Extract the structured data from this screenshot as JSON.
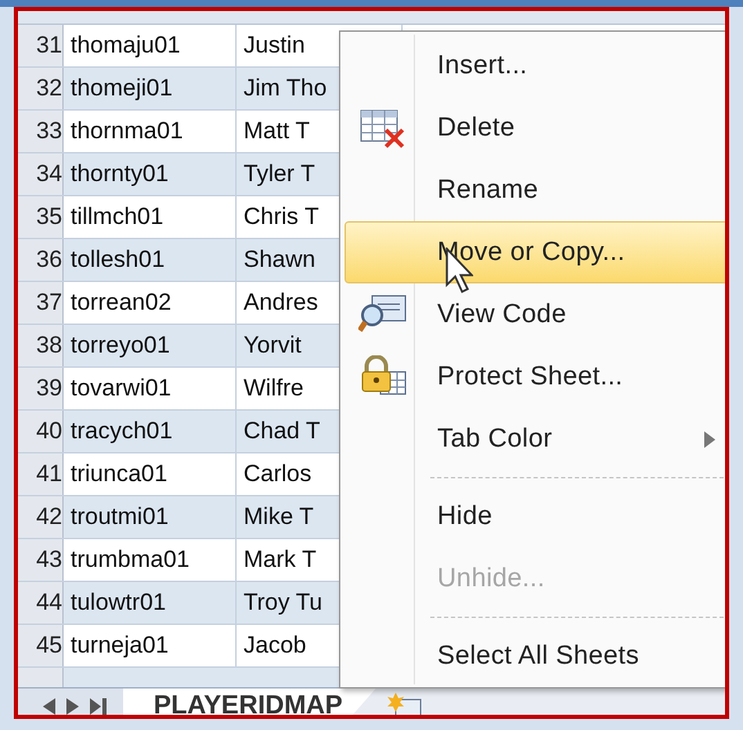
{
  "rows": [
    {
      "number": "31",
      "id": "thomaju01",
      "name": "Justin"
    },
    {
      "number": "32",
      "id": "thomeji01",
      "name": "Jim Tho"
    },
    {
      "number": "33",
      "id": "thornma01",
      "name": "Matt T"
    },
    {
      "number": "34",
      "id": "thornty01",
      "name": "Tyler T"
    },
    {
      "number": "35",
      "id": "tillmch01",
      "name": "Chris T"
    },
    {
      "number": "36",
      "id": "tollesh01",
      "name": "Shawn"
    },
    {
      "number": "37",
      "id": "torrean02",
      "name": "Andres"
    },
    {
      "number": "38",
      "id": "torreyo01",
      "name": "Yorvit"
    },
    {
      "number": "39",
      "id": "tovarwi01",
      "name": "Wilfre"
    },
    {
      "number": "40",
      "id": "tracych01",
      "name": "Chad T"
    },
    {
      "number": "41",
      "id": "triunca01",
      "name": "Carlos"
    },
    {
      "number": "42",
      "id": "troutmi01",
      "name": "Mike T"
    },
    {
      "number": "43",
      "id": "trumbma01",
      "name": "Mark T"
    },
    {
      "number": "44",
      "id": "tulowtr01",
      "name": "Troy Tu"
    },
    {
      "number": "45",
      "id": "turneja01",
      "name": "Jacob"
    }
  ],
  "context_menu": [
    {
      "kind": "item",
      "label": "Insert...",
      "selected": false,
      "disabled": false,
      "has_submenu": false
    },
    {
      "kind": "item",
      "label": "Delete",
      "selected": false,
      "disabled": false,
      "has_submenu": false
    },
    {
      "kind": "item",
      "label": "Rename",
      "selected": false,
      "disabled": false,
      "has_submenu": false
    },
    {
      "kind": "item",
      "label": "Move or Copy...",
      "selected": true,
      "disabled": false,
      "has_submenu": false
    },
    {
      "kind": "item",
      "label": "View Code",
      "selected": false,
      "disabled": false,
      "has_submenu": false
    },
    {
      "kind": "item",
      "label": "Protect Sheet...",
      "selected": false,
      "disabled": false,
      "has_submenu": false
    },
    {
      "kind": "item",
      "label": "Tab Color",
      "selected": false,
      "disabled": false,
      "has_submenu": true
    },
    {
      "kind": "separator"
    },
    {
      "kind": "item",
      "label": "Hide",
      "selected": false,
      "disabled": false,
      "has_submenu": false
    },
    {
      "kind": "item",
      "label": "Unhide...",
      "selected": false,
      "disabled": true,
      "has_submenu": false
    },
    {
      "kind": "separator"
    },
    {
      "kind": "item",
      "label": "Select All Sheets",
      "selected": false,
      "disabled": false,
      "has_submenu": false
    }
  ],
  "sheet_tabs": [
    {
      "label": "PLAYERIDMAP",
      "selected": true
    }
  ]
}
